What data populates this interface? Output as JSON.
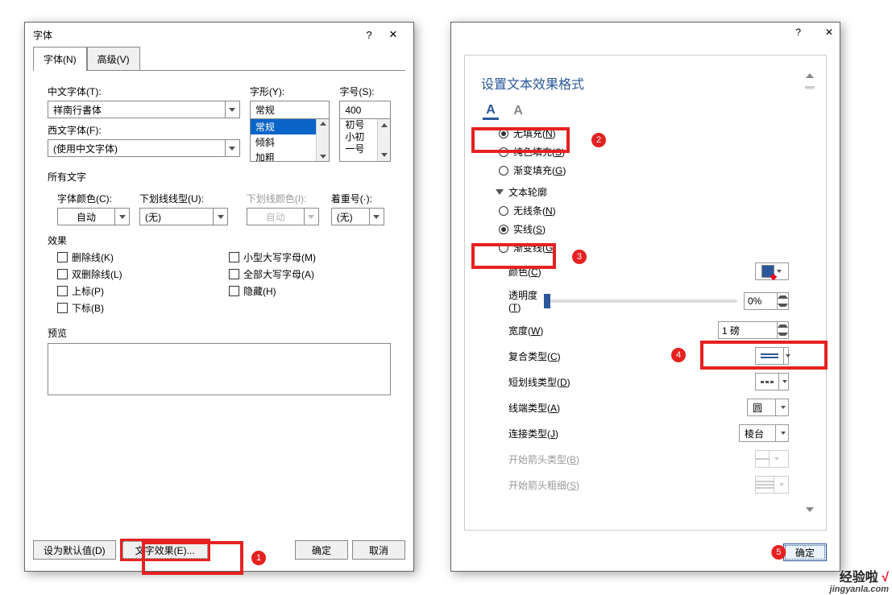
{
  "d1": {
    "title": "字体",
    "help": "?",
    "close": "✕",
    "tab_font": "字体(N)",
    "tab_adv": "高级(V)",
    "lbl_cjk": "中文字体(T):",
    "val_cjk": "祥南行書体",
    "lbl_latin": "西文字体(F):",
    "val_latin": "(使用中文字体)",
    "lbl_style": "字形(Y):",
    "val_style": "常规",
    "style_opts": {
      "a": "常规",
      "b": "倾斜",
      "c": "加粗"
    },
    "lbl_size": "字号(S):",
    "val_size": "400",
    "size_opts": {
      "a": "初号",
      "b": "小初",
      "c": "一号"
    },
    "sec_alltext": "所有文字",
    "lbl_color": "字体颜色(C):",
    "val_color": "自动",
    "lbl_ustyle": "下划线线型(U):",
    "val_ustyle": "(无)",
    "lbl_ucolor": "下划线颜色(I):",
    "val_ucolor": "自动",
    "lbl_emph": "着重号(·):",
    "val_emph": "(无)",
    "sec_effects": "效果",
    "chk": {
      "strike": "删除线(K)",
      "dstrike": "双删除线(L)",
      "sup": "上标(P)",
      "sub": "下标(B)",
      "smallcaps": "小型大写字母(M)",
      "allcaps": "全部大写字母(A)",
      "hidden": "隐藏(H)"
    },
    "sec_preview": "预览",
    "btn_default": "设为默认值(D)",
    "btn_texteff": "文字效果(E)...",
    "btn_ok": "确定",
    "btn_cancel": "取消"
  },
  "d2": {
    "hdr": "设置文本效果格式",
    "help": "?",
    "close": "✕",
    "fill": {
      "none": "无填充(N)",
      "solid": "纯色填充(S)",
      "grad": "渐变填充(G)"
    },
    "outline_hdr": "文本轮廓",
    "outline": {
      "none": "无线条(N)",
      "solid": "实线(S)",
      "grad": "渐变线(G)"
    },
    "props": {
      "color": "颜色(C)",
      "trans": "透明度(T)",
      "trans_val": "0%",
      "width": "宽度(W)",
      "width_val": "1 磅",
      "compound": "复合类型(C)",
      "dash": "短划线类型(D)",
      "cap": "线端类型(A)",
      "cap_val": "圆",
      "join": "连接类型(J)",
      "join_val": "棱台",
      "begintype": "开始箭头类型(B)",
      "beginsize": "开始箭头粗细(S)"
    },
    "btn_ok": "确定"
  },
  "badges": {
    "b1": "1",
    "b2": "2",
    "b3": "3",
    "b4": "4",
    "b5": "5"
  },
  "wm": {
    "line1a": "经验啦",
    "line1b": "√",
    "line2": "jingyanla.com"
  }
}
